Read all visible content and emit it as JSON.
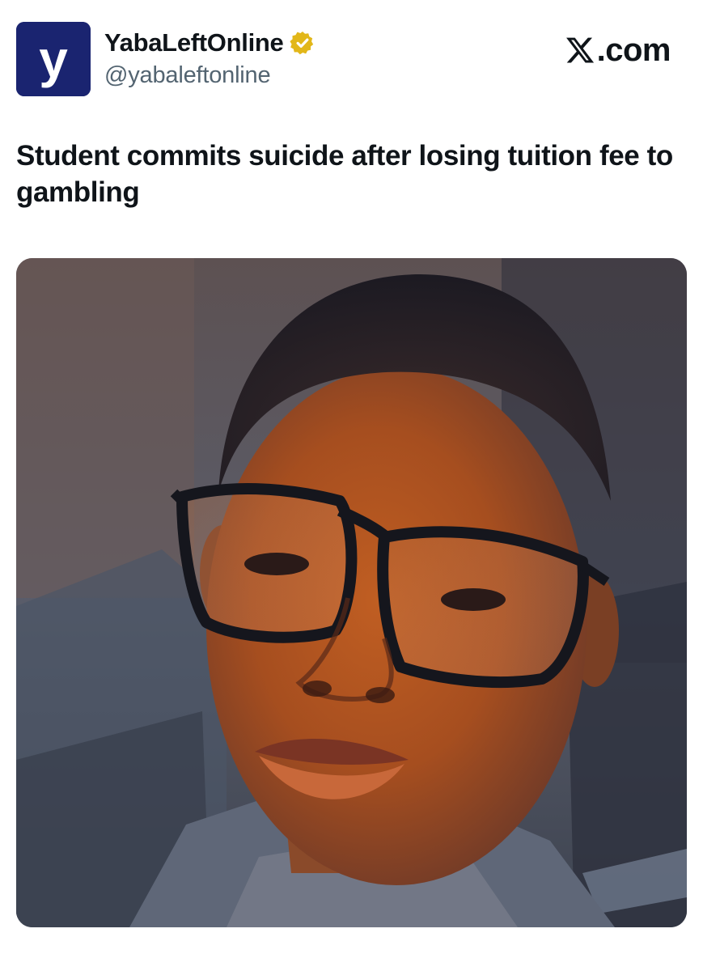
{
  "account": {
    "display_name": "YabaLeftOnline",
    "handle": "@yabaleftonline",
    "avatar_letter": "y",
    "verified": true
  },
  "site": {
    "label": ".com"
  },
  "post": {
    "headline": "Student commits suicide after losing tuition fee to gambling"
  },
  "colors": {
    "avatar_bg": "#1a2470",
    "verified_gold": "#e2b719",
    "handle_gray": "#536471",
    "text": "#0f1419"
  },
  "icons": {
    "verified": "verified-badge-icon",
    "x_logo": "x-logo-icon"
  }
}
